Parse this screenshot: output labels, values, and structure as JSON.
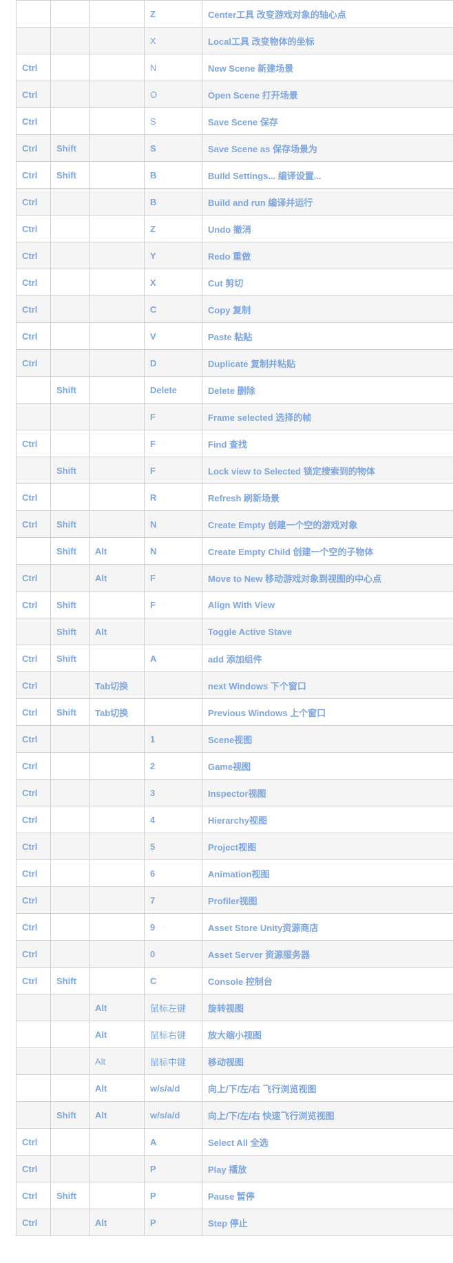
{
  "rows": [
    [
      "",
      "",
      "",
      "Z",
      "Center工具 改变游戏对象的轴心点"
    ],
    [
      "",
      "",
      "",
      "X",
      "Local工具 改变物体的坐标"
    ],
    [
      "Ctrl",
      "",
      "",
      "N",
      "New Scene 新建场景"
    ],
    [
      "Ctrl",
      "",
      "",
      "O",
      "Open Scene 打开场景"
    ],
    [
      "Ctrl",
      "",
      "",
      "S",
      "Save Scene 保存"
    ],
    [
      "Ctrl",
      "Shift",
      "",
      "S",
      "Save Scene as 保存场景为"
    ],
    [
      "Ctrl",
      "Shift",
      "",
      "B",
      "Build Settings... 编译设置..."
    ],
    [
      "Ctrl",
      "",
      "",
      "B",
      "Build and run 编译并运行"
    ],
    [
      "Ctrl",
      "",
      "",
      "Z",
      "Undo 撤消"
    ],
    [
      "Ctrl",
      "",
      "",
      "Y",
      "Redo 重做"
    ],
    [
      "Ctrl",
      "",
      "",
      "X",
      "Cut 剪切"
    ],
    [
      "Ctrl",
      "",
      "",
      "C",
      "Copy 复制"
    ],
    [
      "Ctrl",
      "",
      "",
      "V",
      "Paste 粘贴"
    ],
    [
      "Ctrl",
      "",
      "",
      "D",
      "Duplicate 复制并粘贴"
    ],
    [
      "",
      "Shift",
      "",
      "Delete",
      "Delete 删除"
    ],
    [
      "",
      "",
      "",
      "F",
      "Frame  selected 选择的帧"
    ],
    [
      "Ctrl",
      "",
      "",
      "F",
      "Find 查找"
    ],
    [
      "",
      "Shift",
      "",
      "F",
      "Lock view to Selected 锁定搜索到的物体"
    ],
    [
      "Ctrl",
      "",
      "",
      "R",
      "Refresh 刷新场景"
    ],
    [
      "Ctrl",
      "Shift",
      "",
      "N",
      "Create Empty 创建一个空的游戏对象"
    ],
    [
      "",
      "Shift",
      "Alt",
      "N",
      "Create Empty Child 创建一个空的子物体"
    ],
    [
      "Ctrl",
      "",
      "Alt",
      "F",
      "Move to New 移动游戏对象到视图的中心点"
    ],
    [
      "Ctrl",
      "Shift",
      "",
      "F",
      "Align With View"
    ],
    [
      "",
      "Shift",
      "Alt",
      "",
      "Toggle Active Stave"
    ],
    [
      "Ctrl",
      "Shift",
      "",
      "A",
      "add 添加组件"
    ],
    [
      "Ctrl",
      "",
      "Tab切换",
      "",
      "next Windows 下个窗口"
    ],
    [
      "Ctrl",
      "Shift",
      "Tab切换",
      "",
      "Previous Windows 上个窗口"
    ],
    [
      "Ctrl",
      "",
      "",
      "1",
      "Scene视图"
    ],
    [
      "Ctrl",
      "",
      "",
      "2",
      "Game视图"
    ],
    [
      "Ctrl",
      "",
      "",
      "3",
      "Inspector视图"
    ],
    [
      "Ctrl",
      "",
      "",
      "4",
      "Hierarchy视图"
    ],
    [
      "Ctrl",
      "",
      "",
      "5",
      "Project视图"
    ],
    [
      "Ctrl",
      "",
      "",
      "6",
      "Animation视图"
    ],
    [
      "Ctrl",
      "",
      "",
      "7",
      "Profiler视图"
    ],
    [
      "Ctrl",
      "",
      "",
      "9",
      "Asset Store Unity资源商店"
    ],
    [
      "Ctrl",
      "",
      "",
      "0",
      "Asset Server 资源服务器"
    ],
    [
      "Ctrl",
      "Shift",
      "",
      "C",
      "Console 控制台"
    ],
    [
      "",
      "",
      "Alt",
      "鼠标左键",
      "旋转视图"
    ],
    [
      "",
      "",
      "Alt",
      "鼠标右键",
      "放大缩小视图"
    ],
    [
      "",
      "",
      "Alt",
      "鼠标中键",
      "移动视图"
    ],
    [
      "",
      "",
      "Alt",
      "w/s/a/d",
      "向上/下/左/右 飞行浏览视图"
    ],
    [
      "",
      "Shift",
      "Alt",
      "w/s/a/d",
      "向上/下/左/右 快速飞行浏览视图"
    ],
    [
      "Ctrl",
      "",
      "",
      "A",
      "Select All 全选"
    ],
    [
      "Ctrl",
      "",
      "",
      "P",
      "Play 播放"
    ],
    [
      "Ctrl",
      "Shift",
      "",
      "P",
      "Pause 暂停"
    ],
    [
      "Ctrl",
      "",
      "Alt",
      "P",
      "Step 停止"
    ]
  ]
}
